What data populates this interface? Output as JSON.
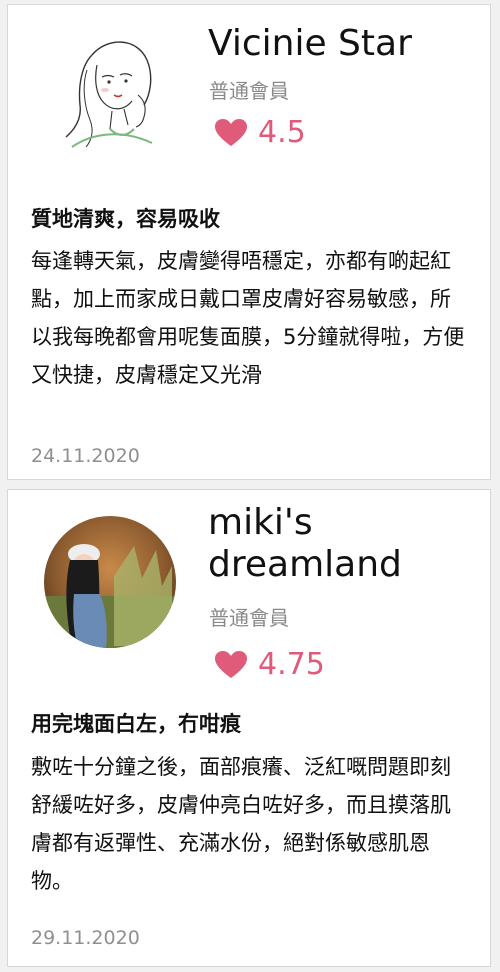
{
  "reviews": [
    {
      "name": "Vicinie Star",
      "member_level": "普通會員",
      "rating": "4.5",
      "title": "質地清爽，容易吸收",
      "body": "每逢轉天氣，皮膚變得唔穩定，亦都有啲起紅點，加上而家成日戴口罩皮膚好容易敏感，所以我每晚都會用呢隻面膜，5分鐘就得啦，方便又快捷，皮膚穩定又光滑",
      "date": "24.11.2020"
    },
    {
      "name": "miki's dreamland",
      "member_level": "普通會員",
      "rating": "4.75",
      "title": "用完塊面白左，冇咁痕",
      "body": "敷咗十分鐘之後，面部痕癢、泛紅嘅問題即刻舒緩咗好多，皮膚仲亮白咗好多，而且摸落肌膚都有返彈性、充滿水份，絕對係敏感肌恩物。",
      "date": "29.11.2020"
    }
  ],
  "colors": {
    "heart": "#e05a7a",
    "muted": "#8a8a8a"
  },
  "icons": [
    "heart-icon",
    "avatar-sketch",
    "avatar-photo"
  ]
}
